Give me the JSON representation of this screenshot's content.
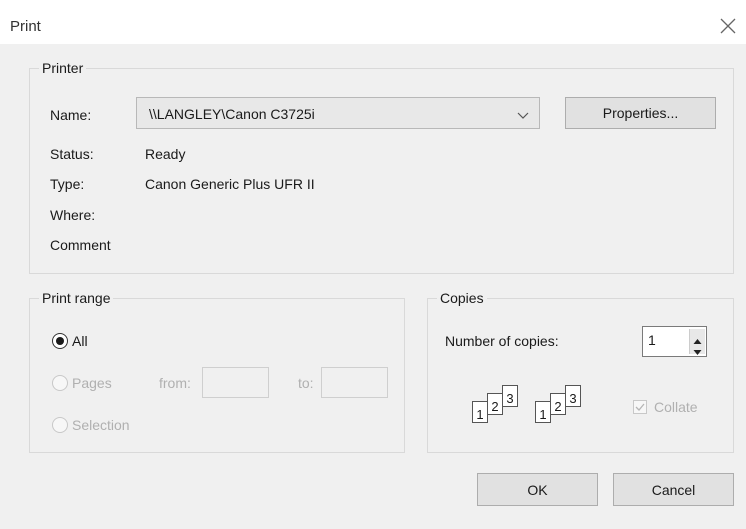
{
  "window": {
    "title": "Print"
  },
  "printer": {
    "legend": "Printer",
    "name_label": "Name:",
    "name_value": "\\\\LANGLEY\\Canon C3725i",
    "properties_label": "Properties...",
    "status_label": "Status:",
    "status_value": "Ready",
    "type_label": "Type:",
    "type_value": "Canon Generic Plus UFR II",
    "where_label": "Where:",
    "comment_label": "Comment"
  },
  "print_range": {
    "legend": "Print range",
    "all_label": "All",
    "pages_label": "Pages",
    "from_label": "from:",
    "to_label": "to:",
    "selection_label": "Selection",
    "selected": "All"
  },
  "copies": {
    "legend": "Copies",
    "number_label": "Number of copies:",
    "number_value": "1",
    "collate_label": "Collate",
    "collate_checked": true,
    "collate_enabled": false,
    "stack_pages": [
      "1",
      "2",
      "3"
    ]
  },
  "buttons": {
    "ok": "OK",
    "cancel": "Cancel"
  },
  "colors": {
    "background": "#f0f0f0",
    "button": "#e1e1e1",
    "disabled_text": "#b0b0b0"
  }
}
